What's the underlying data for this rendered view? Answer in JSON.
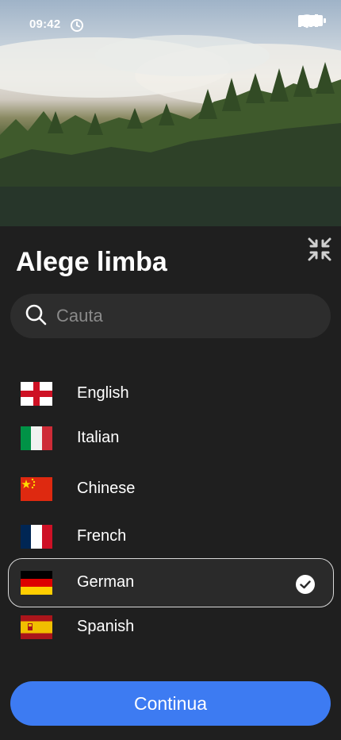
{
  "status_bar": {
    "time": "09:42"
  },
  "sheet": {
    "title": "Alege limba"
  },
  "search": {
    "placeholder": "Cauta",
    "value": ""
  },
  "languages": [
    {
      "label": "English",
      "flag": "england-flag-icon",
      "selected": false
    },
    {
      "label": "Italian",
      "flag": "italy-flag-icon",
      "selected": false
    },
    {
      "label": "Chinese",
      "flag": "china-flag-icon",
      "selected": false
    },
    {
      "label": "French",
      "flag": "france-flag-icon",
      "selected": false
    },
    {
      "label": "German",
      "flag": "germany-flag-icon",
      "selected": true
    },
    {
      "label": "Spanish",
      "flag": "spain-flag-icon",
      "selected": false
    }
  ],
  "actions": {
    "continue_label": "Continua"
  },
  "colors": {
    "accent": "#3d7bf2",
    "background": "#1f1f1f",
    "search_bg": "#2d2d2d"
  }
}
